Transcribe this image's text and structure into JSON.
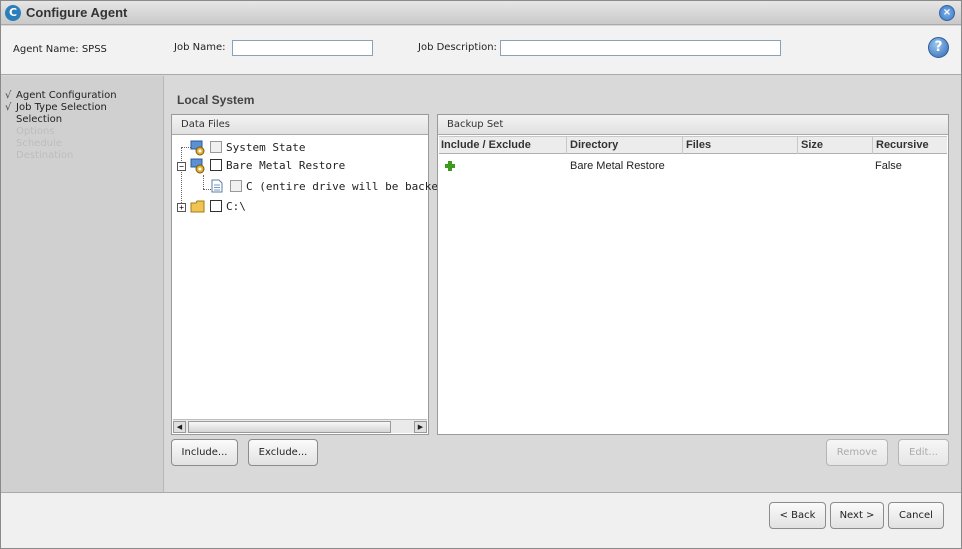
{
  "window": {
    "title": "Configure Agent",
    "app_icon": "C",
    "close_icon": "×"
  },
  "header": {
    "agent_name_label": "Agent Name: SPSS",
    "job_name_label": "Job Name:",
    "job_name_value": "",
    "job_description_label": "Job Description:",
    "job_description_value": "",
    "help_icon": "?"
  },
  "steps": [
    {
      "label": "Agent Configuration",
      "done": true,
      "check": "√"
    },
    {
      "label": "Job Type Selection",
      "done": true,
      "check": "√"
    },
    {
      "label": "Selection",
      "done": false,
      "check": ""
    },
    {
      "label": "Options",
      "done": false,
      "check": ""
    },
    {
      "label": "Schedule",
      "done": false,
      "check": ""
    },
    {
      "label": "Destination",
      "done": false,
      "check": ""
    }
  ],
  "main": {
    "title": "Local System"
  },
  "data_files": {
    "header": "Data Files",
    "tree": [
      {
        "label": "System State",
        "icon": "system-state-icon"
      },
      {
        "label": "Bare Metal Restore",
        "icon": "bare-metal-icon",
        "expander": "−"
      },
      {
        "label": "C (entire drive will be backed up)",
        "icon": "document-icon"
      },
      {
        "label": "C:\\",
        "icon": "folder-icon",
        "expander": "+"
      }
    ],
    "scroll_left": "◀",
    "scroll_right": "▶"
  },
  "backup_set": {
    "header": "Backup Set",
    "columns": [
      "Include / Exclude",
      "Directory",
      "Files",
      "Size",
      "Recursive"
    ],
    "rows": [
      {
        "include_icon": "plus-icon",
        "directory": "Bare Metal Restore",
        "files": "",
        "size": "",
        "recursive": "False"
      }
    ]
  },
  "buttons": {
    "include": "Include...",
    "exclude": "Exclude...",
    "remove": "Remove",
    "edit": "Edit...",
    "back": "< Back",
    "next": "Next >",
    "cancel": "Cancel"
  },
  "colors": {
    "accent": "#2c7fb8",
    "include_green": "#3d9a1c"
  }
}
